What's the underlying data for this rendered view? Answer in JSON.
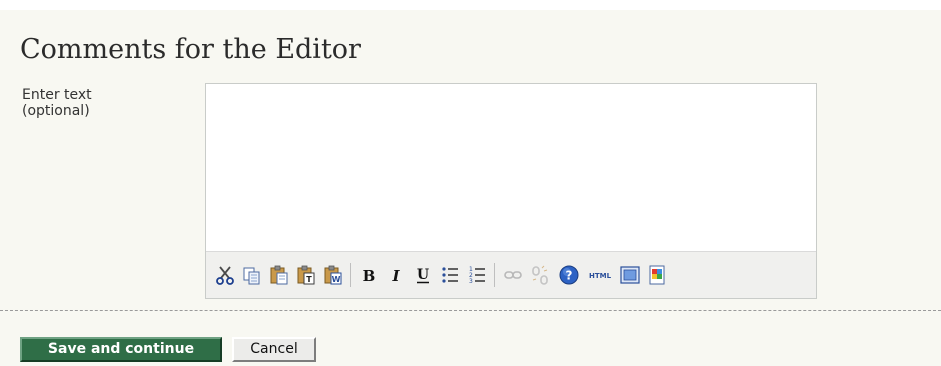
{
  "section": {
    "title": "Comments for the Editor"
  },
  "comments_field": {
    "label_line1": "Enter text",
    "label_line2": "(optional)",
    "value": ""
  },
  "toolbar": {
    "buttons": [
      {
        "name": "cut",
        "icon": "scissors-icon"
      },
      {
        "name": "copy",
        "icon": "copy-icon"
      },
      {
        "name": "paste",
        "icon": "paste-icon"
      },
      {
        "name": "paste-as-text",
        "icon": "paste-text-icon"
      },
      {
        "name": "paste-from-word",
        "icon": "paste-word-icon"
      },
      {
        "name": "bold",
        "icon": "bold-icon",
        "glyph": "B"
      },
      {
        "name": "italic",
        "icon": "italic-icon",
        "glyph": "I"
      },
      {
        "name": "underline",
        "icon": "underline-icon",
        "glyph": "U"
      },
      {
        "name": "bullet-list",
        "icon": "bullet-list-icon"
      },
      {
        "name": "numbered-list",
        "icon": "numbered-list-icon"
      },
      {
        "name": "insert-link",
        "icon": "link-icon",
        "disabled": true
      },
      {
        "name": "remove-link",
        "icon": "unlink-icon",
        "disabled": true
      },
      {
        "name": "help",
        "icon": "help-icon",
        "glyph": "?"
      },
      {
        "name": "html-source",
        "icon": "html-icon",
        "glyph": "HTML"
      },
      {
        "name": "fullscreen",
        "icon": "fullscreen-icon"
      },
      {
        "name": "insert-image",
        "icon": "image-icon"
      }
    ]
  },
  "actions": {
    "save_label": "Save and continue",
    "cancel_label": "Cancel"
  },
  "colors": {
    "page_background": "#f8f8f2",
    "primary_button": "#2f6e47",
    "toolbar_background": "#f0f0ee",
    "editor_border": "#c9ccc9"
  }
}
